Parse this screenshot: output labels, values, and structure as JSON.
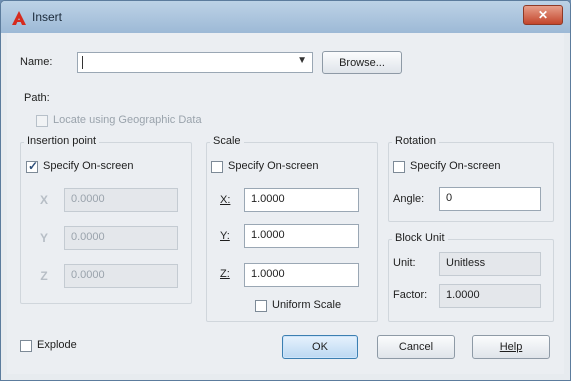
{
  "window": {
    "title": "Insert",
    "close_icon": "close-icon",
    "app_icon": "autocad-icon"
  },
  "name_field": {
    "label": "Name:",
    "value": ""
  },
  "buttons": {
    "browse": "Browse...",
    "ok": "OK",
    "cancel": "Cancel",
    "help": "Help"
  },
  "path": {
    "label": "Path:",
    "value": ""
  },
  "geo_checkbox": {
    "label": "Locate using Geographic Data",
    "checked": false,
    "enabled": false
  },
  "insertion_point": {
    "title": "Insertion point",
    "specify_label": "Specify On-screen",
    "specify_checked": true,
    "x_value": "0.0000",
    "y_value": "0.0000",
    "z_value": "0.0000"
  },
  "scale": {
    "title": "Scale",
    "specify_label": "Specify On-screen",
    "specify_checked": false,
    "x_label": "X:",
    "y_label": "Y:",
    "z_label": "Z:",
    "x_value": "1.0000",
    "y_value": "1.0000",
    "z_value": "1.0000",
    "uniform_label": "Uniform Scale",
    "uniform_checked": false
  },
  "rotation": {
    "title": "Rotation",
    "specify_label": "Specify On-screen",
    "specify_checked": false,
    "angle_label": "Angle:",
    "angle_value": "0"
  },
  "block_unit": {
    "title": "Block Unit",
    "unit_label": "Unit:",
    "unit_value": "Unitless",
    "factor_label": "Factor:",
    "factor_value": "1.0000"
  },
  "explode": {
    "label": "Explode",
    "checked": false
  }
}
